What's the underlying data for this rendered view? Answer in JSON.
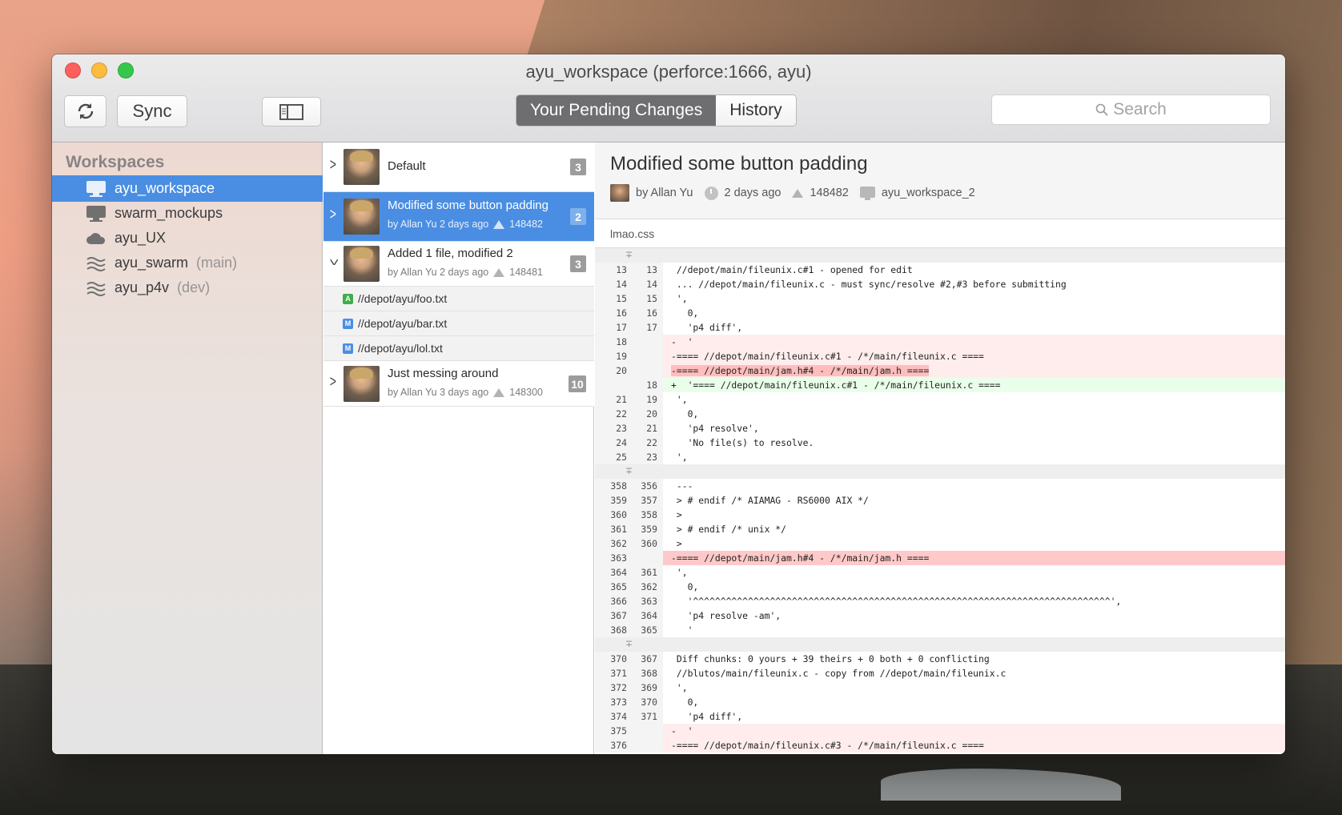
{
  "window": {
    "title": "ayu_workspace (perforce:1666, ayu)"
  },
  "toolbar": {
    "refresh_icon": "refresh-icon",
    "sync_label": "Sync",
    "sidebar_toggle_icon": "sidebar-toggle-icon",
    "tabs": [
      {
        "label": "Your Pending Changes",
        "active": true
      },
      {
        "label": "History",
        "active": false
      }
    ],
    "search_placeholder": "Search"
  },
  "sidebar": {
    "heading": "Workspaces",
    "items": [
      {
        "label": "ayu_workspace",
        "sub": "",
        "icon": "monitor-icon",
        "selected": true
      },
      {
        "label": "swarm_mockups",
        "sub": "",
        "icon": "monitor-icon",
        "selected": false
      },
      {
        "label": "ayu_UX",
        "sub": "",
        "icon": "cloud-icon",
        "selected": false
      },
      {
        "label": "ayu_swarm",
        "sub": "(main)",
        "icon": "stream-icon",
        "selected": false
      },
      {
        "label": "ayu_p4v",
        "sub": "(dev)",
        "icon": "stream-icon",
        "selected": false
      }
    ]
  },
  "changes": [
    {
      "title": "Default",
      "meta": "",
      "change": "",
      "count": "3",
      "selected": false,
      "expanded": false
    },
    {
      "title": "Modified some button padding",
      "meta": "by Allan Yu 2 days ago",
      "change": "148482",
      "count": "2",
      "selected": true,
      "expanded": false
    },
    {
      "title": "Added 1 file, modified 2",
      "meta": "by Allan Yu 2 days ago",
      "change": "148481",
      "count": "3",
      "selected": false,
      "expanded": true
    },
    {
      "title": "Just messing around",
      "meta": "by Allan Yu 3 days ago",
      "change": "148300",
      "count": "10",
      "selected": false,
      "expanded": false
    }
  ],
  "files": [
    {
      "tag": "A",
      "path": "//depot/ayu/foo.txt"
    },
    {
      "tag": "M",
      "path": "//depot/ayu/bar.txt"
    },
    {
      "tag": "M",
      "path": "//depot/ayu/lol.txt"
    }
  ],
  "detail": {
    "title": "Modified some button padding",
    "author": "by Allan Yu",
    "time": "2 days ago",
    "change": "148482",
    "workspace": "ayu_workspace_2",
    "file": "lmao.css"
  },
  "diff": [
    {
      "t": "hunk"
    },
    {
      "t": "ctx",
      "a": "13",
      "b": "13",
      "c": " //depot/main/fileunix.c#1 - opened for edit"
    },
    {
      "t": "ctx",
      "a": "14",
      "b": "14",
      "c": " ... //depot/main/fileunix.c - must sync/resolve #2,#3 before submitting"
    },
    {
      "t": "ctx",
      "a": "15",
      "b": "15",
      "c": " ',"
    },
    {
      "t": "ctx",
      "a": "16",
      "b": "16",
      "c": "   0,"
    },
    {
      "t": "ctx",
      "a": "17",
      "b": "17",
      "c": "   'p4 diff',"
    },
    {
      "t": "del",
      "a": "18",
      "b": "",
      "c": "-  '"
    },
    {
      "t": "del",
      "a": "19",
      "b": "",
      "c": "-==== //depot/main/fileunix.c#1 - /*/main/fileunix.c ===="
    },
    {
      "t": "delhl",
      "a": "20",
      "b": "",
      "c": "-==== //depot/main/jam.h#4 - /*/main/jam.h ===="
    },
    {
      "t": "add",
      "a": "",
      "b": "18",
      "c": "+  '==== //depot/main/fileunix.c#1 - /*/main/fileunix.c ===="
    },
    {
      "t": "ctx",
      "a": "21",
      "b": "19",
      "c": " ',"
    },
    {
      "t": "ctx",
      "a": "22",
      "b": "20",
      "c": "   0,"
    },
    {
      "t": "ctx",
      "a": "23",
      "b": "21",
      "c": "   'p4 resolve',"
    },
    {
      "t": "ctx",
      "a": "24",
      "b": "22",
      "c": "   'No file(s) to resolve."
    },
    {
      "t": "ctx",
      "a": "25",
      "b": "23",
      "c": " ',"
    },
    {
      "t": "hunk"
    },
    {
      "t": "ctx",
      "a": "358",
      "b": "356",
      "c": " ---"
    },
    {
      "t": "ctx",
      "a": "359",
      "b": "357",
      "c": " > # endif /* AIAMAG - RS6000 AIX */"
    },
    {
      "t": "ctx",
      "a": "360",
      "b": "358",
      "c": " >"
    },
    {
      "t": "ctx",
      "a": "361",
      "b": "359",
      "c": " > # endif /* unix */"
    },
    {
      "t": "ctx",
      "a": "362",
      "b": "360",
      "c": " >"
    },
    {
      "t": "delh",
      "a": "363",
      "b": "",
      "c": "-==== //depot/main/jam.h#4 - /*/main/jam.h ===="
    },
    {
      "t": "ctx",
      "a": "364",
      "b": "361",
      "c": " ',"
    },
    {
      "t": "ctx",
      "a": "365",
      "b": "362",
      "c": "   0,"
    },
    {
      "t": "ctx",
      "a": "366",
      "b": "363",
      "c": "   '^^^^^^^^^^^^^^^^^^^^^^^^^^^^^^^^^^^^^^^^^^^^^^^^^^^^^^^^^^^^^^^^^^^^^^^^^^^^',"
    },
    {
      "t": "ctx",
      "a": "367",
      "b": "364",
      "c": "   'p4 resolve -am',"
    },
    {
      "t": "ctx",
      "a": "368",
      "b": "365",
      "c": "   '"
    },
    {
      "t": "hunk"
    },
    {
      "t": "ctx",
      "a": "370",
      "b": "367",
      "c": " Diff chunks: 0 yours + 39 theirs + 0 both + 0 conflicting"
    },
    {
      "t": "ctx",
      "a": "371",
      "b": "368",
      "c": " //blutos/main/fileunix.c - copy from //depot/main/fileunix.c"
    },
    {
      "t": "ctx",
      "a": "372",
      "b": "369",
      "c": " ',"
    },
    {
      "t": "ctx",
      "a": "373",
      "b": "370",
      "c": "   0,"
    },
    {
      "t": "ctx",
      "a": "374",
      "b": "371",
      "c": "   'p4 diff',"
    },
    {
      "t": "del",
      "a": "375",
      "b": "",
      "c": "-  '"
    },
    {
      "t": "del",
      "a": "376",
      "b": "",
      "c": "-==== //depot/main/fileunix.c#3 - /*/main/fileunix.c ===="
    }
  ]
}
